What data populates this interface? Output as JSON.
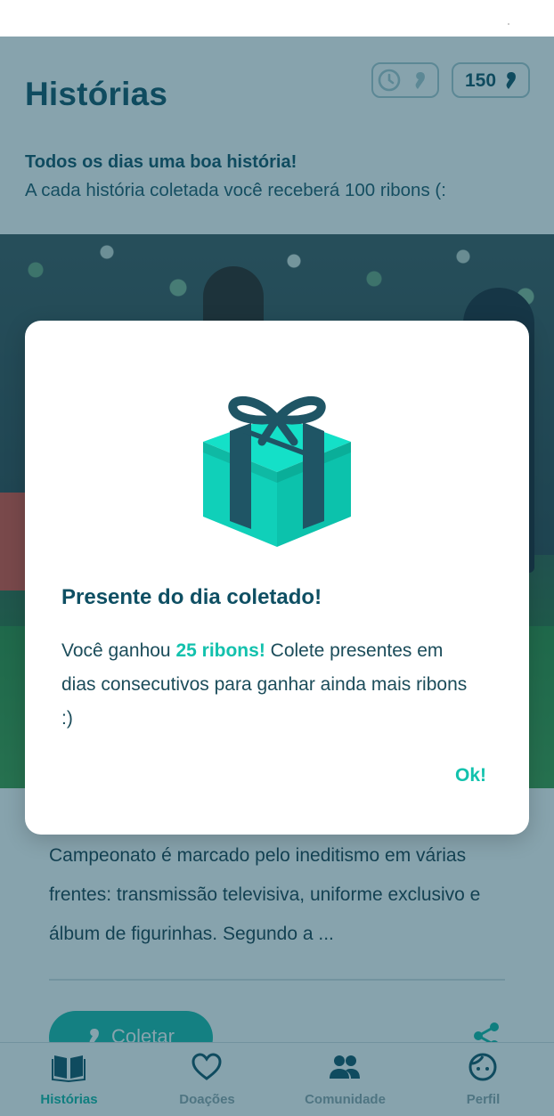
{
  "header": {
    "title": "Histórias",
    "ribbons_balance": "150",
    "tagline_bold": "Todos os dias uma boa história!",
    "tagline": "A cada história coletada você receberá 100 ribons (:"
  },
  "story": {
    "excerpt": "Campeonato é marcado pelo ineditismo em várias frentes: transmissão televisiva, uniforme exclusivo e álbum de figurinhas. Segundo a ...",
    "collect_label": "Coletar"
  },
  "modal": {
    "title": "Presente do dia coletado!",
    "body_prefix": "Você ganhou ",
    "body_highlight": "25 ribons!",
    "body_suffix": " Colete presentes em dias consecutivos para ganhar ainda mais ribons :)",
    "ok_label": "Ok!"
  },
  "bottom_nav": [
    {
      "label": "Histórias",
      "icon": "book-icon",
      "active": true
    },
    {
      "label": "Doações",
      "icon": "heart-icon",
      "active": false
    },
    {
      "label": "Comunidade",
      "icon": "people-icon",
      "active": false
    },
    {
      "label": "Perfil",
      "icon": "face-icon",
      "active": false
    }
  ],
  "colors": {
    "primary_dark": "#0e4f63",
    "accent": "#13c1ad",
    "gift_teal": "#12d3bd",
    "ribbon_dark": "#1f5565"
  }
}
